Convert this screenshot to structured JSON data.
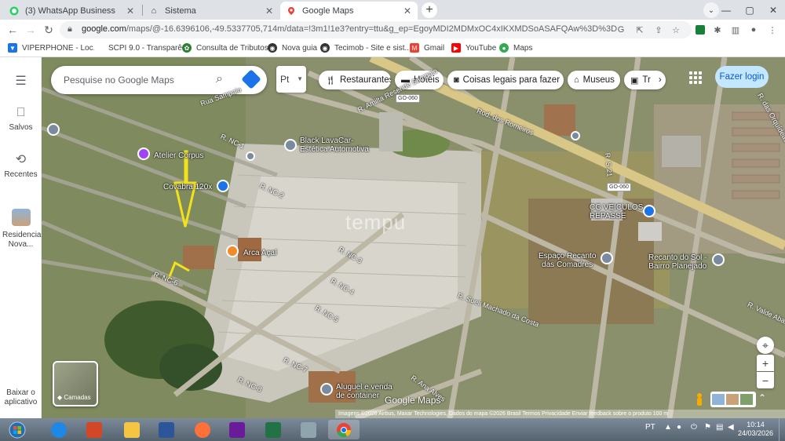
{
  "tabs": [
    {
      "title": "(3) WhatsApp Business",
      "icon": "whatsapp-icon"
    },
    {
      "title": "Sistema",
      "icon": "home-icon"
    },
    {
      "title": "Google Maps",
      "icon": "maps-pin-icon",
      "active": true
    }
  ],
  "toolbar": {
    "url_host": "google.com",
    "url_path": "/maps/@-16.6396106,-49.5337705,714m/data=!3m1!1e3?entry=ttu&g_ep=EgoyMDI2MDMxOC4xIKXMDSoASAFQAw%3D%3D"
  },
  "bookmarks": [
    {
      "label": "VIPERPHONE - Loc...",
      "color": "#1a73e8"
    },
    {
      "label": "SCPI 9.0 - Transparê...",
      "color": "#ffffff"
    },
    {
      "label": "Consulta de Tributos",
      "color": "#2e7d32"
    },
    {
      "label": "Nova guia",
      "color": "#333333"
    },
    {
      "label": "Tecimob - Site e sist...",
      "color": "#333333"
    },
    {
      "label": "Gmail",
      "color": "#ea4335"
    },
    {
      "label": "YouTube",
      "color": "#ff0000"
    },
    {
      "label": "Maps",
      "color": "#34a853"
    }
  ],
  "rail": {
    "saved": "Salvos",
    "recent": "Recentes",
    "recent_place": "Residencial Nova...",
    "download": "Baixar o aplicativo"
  },
  "search": {
    "placeholder": "Pesquise no Google Maps",
    "lang": "Pt"
  },
  "chips": [
    "Restaurantes",
    "Hotéis",
    "Coisas legais para fazer",
    "Museus",
    "Tr"
  ],
  "login": "Fazer login",
  "places": [
    {
      "name": "Black LavaCar-\nEstética Automotiva"
    },
    {
      "name": "Atelier Corpus"
    },
    {
      "name": "Covabra 120x"
    },
    {
      "name": "Arca Açaí"
    },
    {
      "name": "CG VEICULOS\nREPASSE"
    },
    {
      "name": "Espaço Recanto\ndas Comadres"
    },
    {
      "name": "Recanto do Sol -\nBairro Planejado"
    },
    {
      "name": "Aluguel e venda\nde container"
    }
  ],
  "roads": [
    {
      "name": "Rua Sampaio"
    },
    {
      "name": "R. Amilta Resende Sampaio"
    },
    {
      "name": "Rod. dos Romeiros"
    },
    {
      "name": "R. NC-1"
    },
    {
      "name": "R. NC-2"
    },
    {
      "name": "R. NC-3"
    },
    {
      "name": "R. NC-4"
    },
    {
      "name": "R. NC-5"
    },
    {
      "name": "R. NC-6"
    },
    {
      "name": "R. NC-7"
    },
    {
      "name": "R. NC-8"
    },
    {
      "name": "R. Sueli Machado da Costa"
    },
    {
      "name": "R. Ana Alves"
    },
    {
      "name": "R. das Orquídeas"
    },
    {
      "name": "R. Valde Aba..."
    },
    {
      "name": "R. S-21"
    }
  ],
  "shields": [
    "GO-060",
    "GO-060"
  ],
  "watermarks": {
    "tempu": "tempu",
    "google": "Google Maps"
  },
  "layers_label": "Camadas",
  "attribution": "Imagens ©2026 Airbus, Maxar Technologies, Dados do mapa ©2026    Brasil    Termos    Privacidade    Enviar feedback sobre o produto    100 m",
  "tray": {
    "lang": "PT",
    "time": "10:14",
    "date": "24/03/2026"
  }
}
